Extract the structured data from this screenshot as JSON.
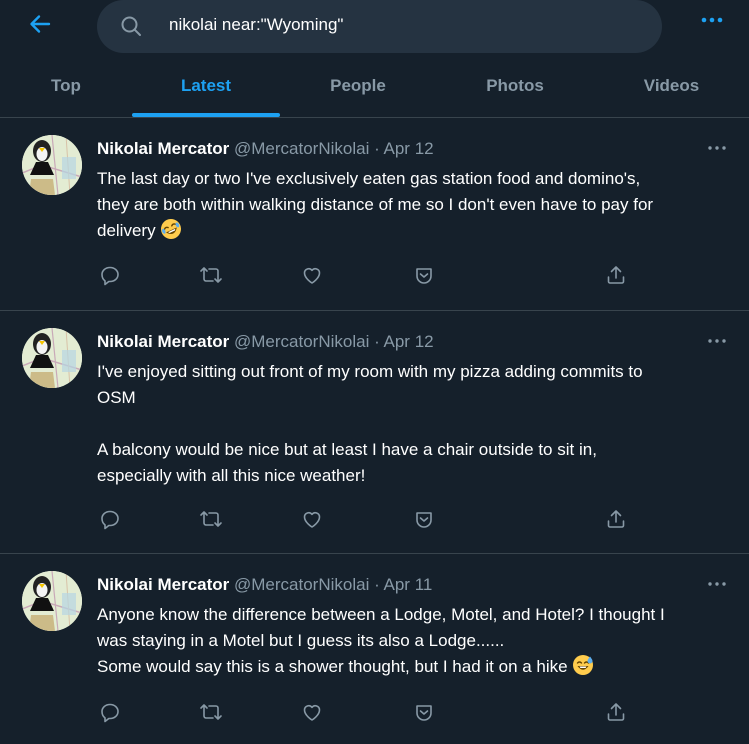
{
  "search": {
    "query": "nikolai near:\"Wyoming\""
  },
  "tabs": [
    {
      "label": "Top"
    },
    {
      "label": "Latest"
    },
    {
      "label": "People"
    },
    {
      "label": "Photos"
    },
    {
      "label": "Videos"
    }
  ],
  "active_tab": "Latest",
  "colors": {
    "background": "#15202b",
    "accent": "#1da1f2",
    "muted": "#8899a6",
    "divider": "#38444d"
  },
  "icons": [
    "back-arrow-icon",
    "search-icon",
    "more-icon",
    "reply-icon",
    "retweet-icon",
    "like-icon",
    "bookmark-icon",
    "share-icon"
  ],
  "tweets": [
    {
      "name": "Nikolai Mercator",
      "meta": "@MercatorNikolai · Apr 12",
      "lines": [
        "The last day or two I've exclusively eaten gas station food and domino's,",
        "they are both within walking distance of me so I don't even have to pay for",
        "delivery"
      ],
      "emoji": "rofl-emoji"
    },
    {
      "name": "Nikolai Mercator",
      "meta": "@MercatorNikolai · Apr 12",
      "lines": [
        "I've enjoyed sitting out front of my room with my pizza adding commits to",
        "OSM",
        "",
        "A balcony would be nice but at least I have a chair outside to sit in,",
        "especially with all this nice weather!"
      ]
    },
    {
      "name": "Nikolai Mercator",
      "meta": "@MercatorNikolai · Apr 11",
      "lines": [
        "Anyone know the difference between a Lodge, Motel, and Hotel? I thought I",
        "was staying in a Motel but I guess its also a Lodge......",
        "Some would say this is a shower thought, but I had it on a hike"
      ],
      "emoji": "sweat-smile-emoji"
    }
  ]
}
